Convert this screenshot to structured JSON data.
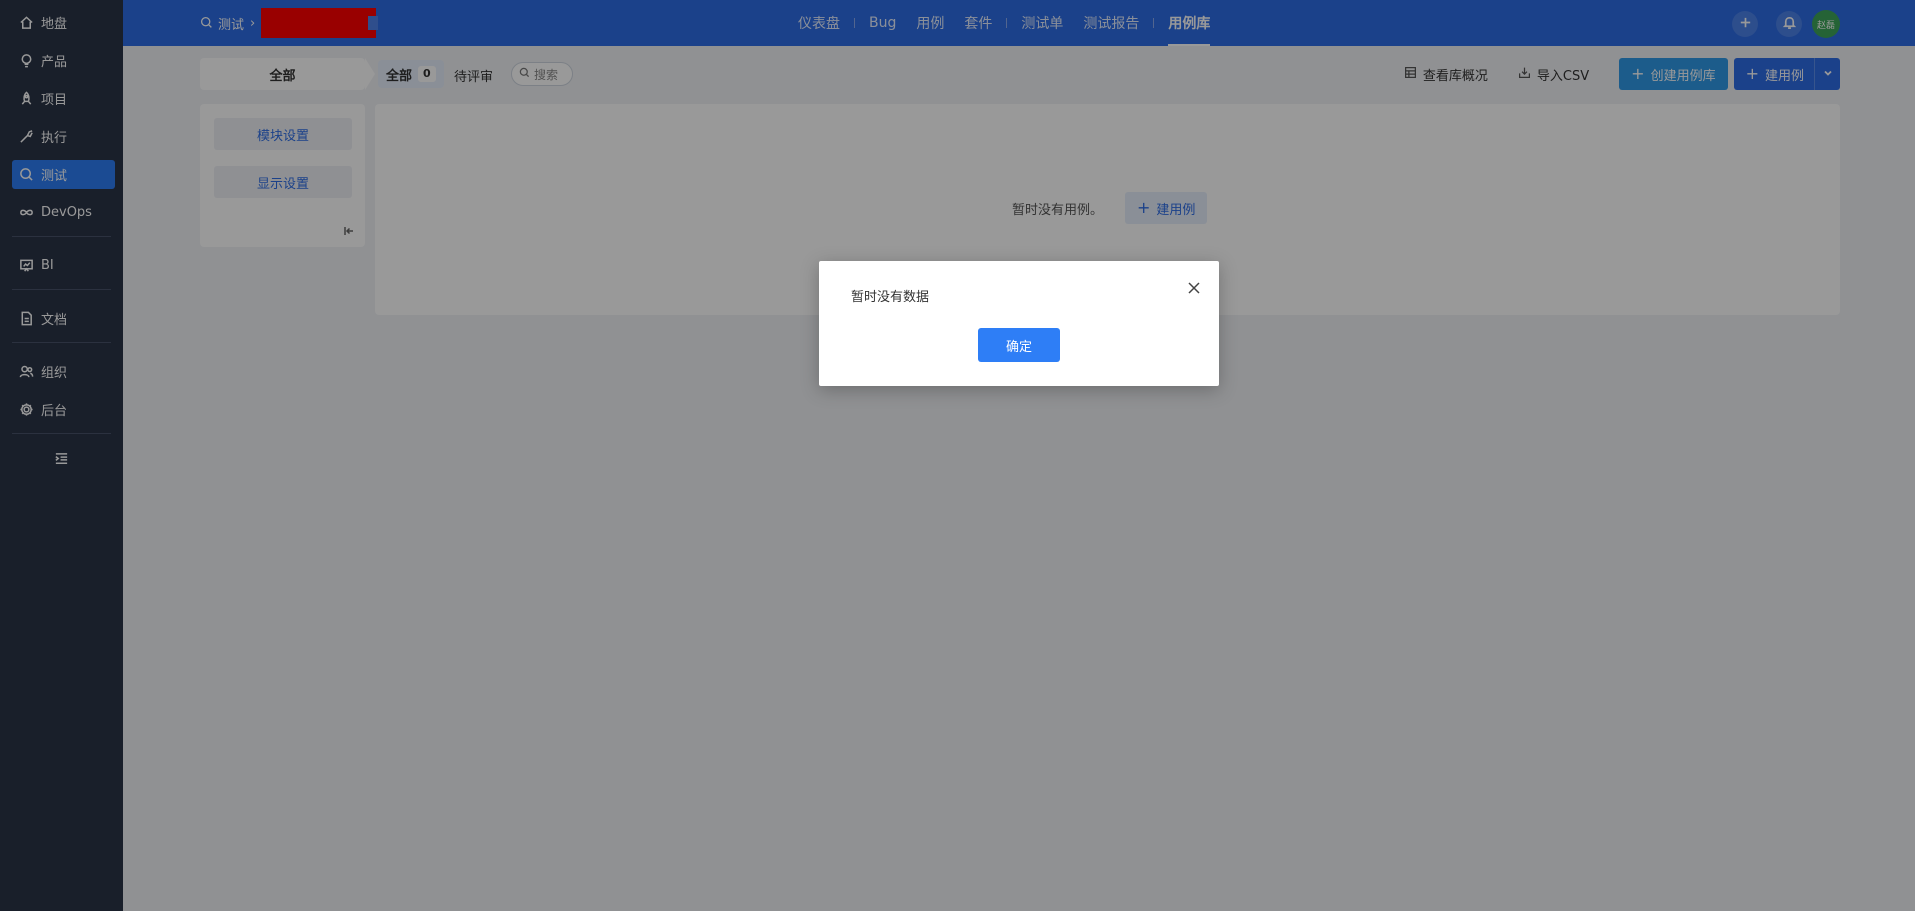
{
  "sidebar": {
    "items": [
      {
        "label": "地盘",
        "icon": "home-icon"
      },
      {
        "label": "产品",
        "icon": "lightbulb-icon"
      },
      {
        "label": "项目",
        "icon": "rocket-icon"
      },
      {
        "label": "执行",
        "icon": "run-icon"
      },
      {
        "label": "测试",
        "icon": "search-icon",
        "active": true
      },
      {
        "label": "DevOps",
        "icon": "infinity-icon"
      },
      {
        "label": "BI",
        "icon": "chart-board-icon"
      },
      {
        "label": "文档",
        "icon": "document-icon"
      },
      {
        "label": "组织",
        "icon": "users-icon"
      },
      {
        "label": "后台",
        "icon": "gear-icon"
      }
    ]
  },
  "header": {
    "breadcrumb_root": "测试",
    "nav": [
      {
        "label": "仪表盘"
      },
      {
        "label": "Bug"
      },
      {
        "label": "用例"
      },
      {
        "label": "套件"
      },
      {
        "label": "测试单"
      },
      {
        "label": "测试报告"
      },
      {
        "label": "用例库",
        "active": true
      }
    ],
    "avatar_text": "赵磊"
  },
  "toolbar": {
    "module_tab": "全部",
    "all_label": "全部",
    "all_count": "0",
    "pending_label": "待评审",
    "search_label": "搜索",
    "view_overview": "查看库概况",
    "import_csv": "导入CSV",
    "create_library": "创建用例库",
    "create_case": "建用例"
  },
  "left_panel": {
    "module_settings": "模块设置",
    "display_settings": "显示设置"
  },
  "main": {
    "empty_text": "暂时没有用例。",
    "empty_button": "建用例"
  },
  "modal": {
    "message": "暂时没有数据",
    "ok_label": "确定"
  },
  "colors": {
    "header": "#2e6de6",
    "sidebar": "#2b3447",
    "accent": "#2e7ef6"
  }
}
